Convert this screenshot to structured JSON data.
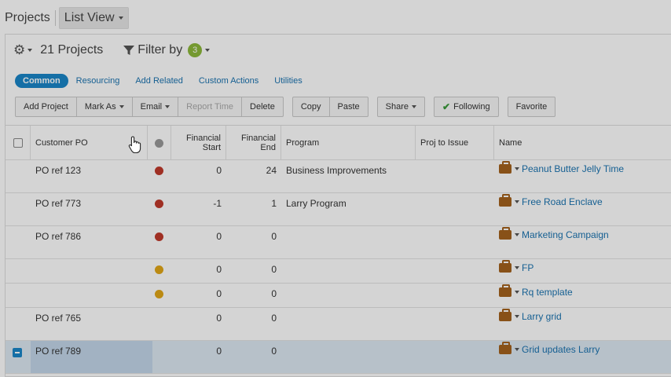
{
  "breadcrumb": {
    "root": "Projects",
    "view": "List View"
  },
  "topbar": {
    "count_label": "21 Projects",
    "filter_label": "Filter by",
    "filter_count": "3"
  },
  "tabs": [
    "Common",
    "Resourcing",
    "Add Related",
    "Custom Actions",
    "Utilities"
  ],
  "toolbar": {
    "add_project": "Add Project",
    "mark_as": "Mark As",
    "email": "Email",
    "report_time": "Report Time",
    "delete": "Delete",
    "copy": "Copy",
    "paste": "Paste",
    "share": "Share",
    "following": "Following",
    "favorite": "Favorite"
  },
  "columns": {
    "customer_po": "Customer PO",
    "financial_start": "Financial Start",
    "financial_end": "Financial End",
    "program": "Program",
    "proj_to_issue": "Proj to Issue",
    "name": "Name"
  },
  "rows": [
    {
      "po": "PO ref 123",
      "status": "#c0392b",
      "start": "0",
      "end": "24",
      "program": "Business Improvements",
      "issue": "",
      "name": "Peanut Butter Jelly Time"
    },
    {
      "po": "PO ref 773",
      "status": "#c0392b",
      "start": "-1",
      "end": "1",
      "program": "Larry Program",
      "issue": "",
      "name": "Free Road Enclave"
    },
    {
      "po": "PO ref 786",
      "status": "#c0392b",
      "start": "0",
      "end": "0",
      "program": "",
      "issue": "",
      "name": "Marketing Campaign"
    },
    {
      "po": "",
      "status": "#e1a718",
      "start": "0",
      "end": "0",
      "program": "",
      "issue": "",
      "name": "FP"
    },
    {
      "po": "",
      "status": "#e1a718",
      "start": "0",
      "end": "0",
      "program": "",
      "issue": "",
      "name": "Rq template"
    },
    {
      "po": "PO ref 765",
      "status": "",
      "start": "0",
      "end": "0",
      "program": "",
      "issue": "",
      "name": "Larry grid"
    },
    {
      "po": "PO ref 789",
      "status": "",
      "start": "0",
      "end": "0",
      "program": "",
      "issue": "",
      "name": "Grid updates Larry"
    }
  ],
  "colors": {
    "accent": "#1a86c8",
    "link": "#1a73b0",
    "red_status": "#c0392b",
    "yellow_status": "#e1a718",
    "badge": "#8cb83a",
    "project_icon": "#a4621d"
  }
}
